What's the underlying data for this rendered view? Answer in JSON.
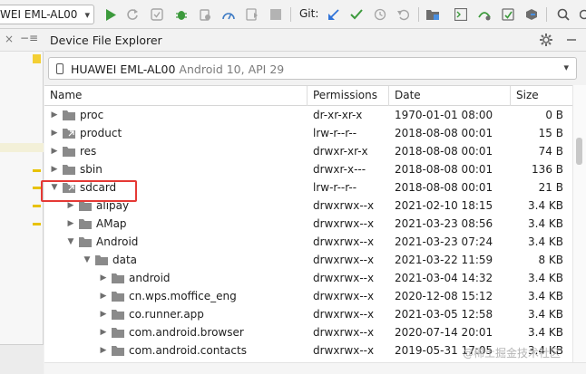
{
  "toolbar": {
    "device_selector": "WEI EML-AL00",
    "git_label": "Git:"
  },
  "panel": {
    "title": "Device File Explorer",
    "device_name": "HUAWEI EML-AL00",
    "device_info": "Android 10, API 29"
  },
  "table": {
    "columns": [
      "Name",
      "Permissions",
      "Date",
      "Size"
    ],
    "rows": [
      {
        "name": "proc",
        "perm": "dr-xr-xr-x",
        "date": "1970-01-01 08:00",
        "size": "0 B",
        "depth": 0,
        "expanded": false,
        "link": false
      },
      {
        "name": "product",
        "perm": "lrw-r--r--",
        "date": "2018-08-08 00:01",
        "size": "15 B",
        "depth": 0,
        "expanded": false,
        "link": true
      },
      {
        "name": "res",
        "perm": "drwxr-xr-x",
        "date": "2018-08-08 00:01",
        "size": "74 B",
        "depth": 0,
        "expanded": false,
        "link": false
      },
      {
        "name": "sbin",
        "perm": "drwxr-x---",
        "date": "2018-08-08 00:01",
        "size": "136 B",
        "depth": 0,
        "expanded": false,
        "link": false
      },
      {
        "name": "sdcard",
        "perm": "lrw-r--r--",
        "date": "2018-08-08 00:01",
        "size": "21 B",
        "depth": 0,
        "expanded": true,
        "link": true
      },
      {
        "name": "alipay",
        "perm": "drwxrwx--x",
        "date": "2021-02-10 18:15",
        "size": "3.4 KB",
        "depth": 1,
        "expanded": false,
        "link": false
      },
      {
        "name": "AMap",
        "perm": "drwxrwx--x",
        "date": "2021-03-23 08:56",
        "size": "3.4 KB",
        "depth": 1,
        "expanded": false,
        "link": false
      },
      {
        "name": "Android",
        "perm": "drwxrwx--x",
        "date": "2021-03-23 07:24",
        "size": "3.4 KB",
        "depth": 1,
        "expanded": true,
        "link": false
      },
      {
        "name": "data",
        "perm": "drwxrwx--x",
        "date": "2021-03-22 11:59",
        "size": "8 KB",
        "depth": 2,
        "expanded": true,
        "link": false
      },
      {
        "name": "android",
        "perm": "drwxrwx--x",
        "date": "2021-03-04 14:32",
        "size": "3.4 KB",
        "depth": 3,
        "expanded": false,
        "link": false
      },
      {
        "name": "cn.wps.moffice_eng",
        "perm": "drwxrwx--x",
        "date": "2020-12-08 15:12",
        "size": "3.4 KB",
        "depth": 3,
        "expanded": false,
        "link": false
      },
      {
        "name": "co.runner.app",
        "perm": "drwxrwx--x",
        "date": "2021-03-05 12:58",
        "size": "3.4 KB",
        "depth": 3,
        "expanded": false,
        "link": false
      },
      {
        "name": "com.android.browser",
        "perm": "drwxrwx--x",
        "date": "2020-07-14 20:01",
        "size": "3.4 KB",
        "depth": 3,
        "expanded": false,
        "link": false
      },
      {
        "name": "com.android.contacts",
        "perm": "drwxrwx--x",
        "date": "2019-05-31 17:05",
        "size": "3.4 KB",
        "depth": 3,
        "expanded": false,
        "link": false
      }
    ]
  },
  "watermark": "@稀土掘金技术社区",
  "colors": {
    "run": "#3c9a3c",
    "debug": "#3c9a3c",
    "git_update": "#2f73d8",
    "git_commit": "#3c9a3c",
    "highlight": "#e53935",
    "folder": "#8a8a8a"
  }
}
